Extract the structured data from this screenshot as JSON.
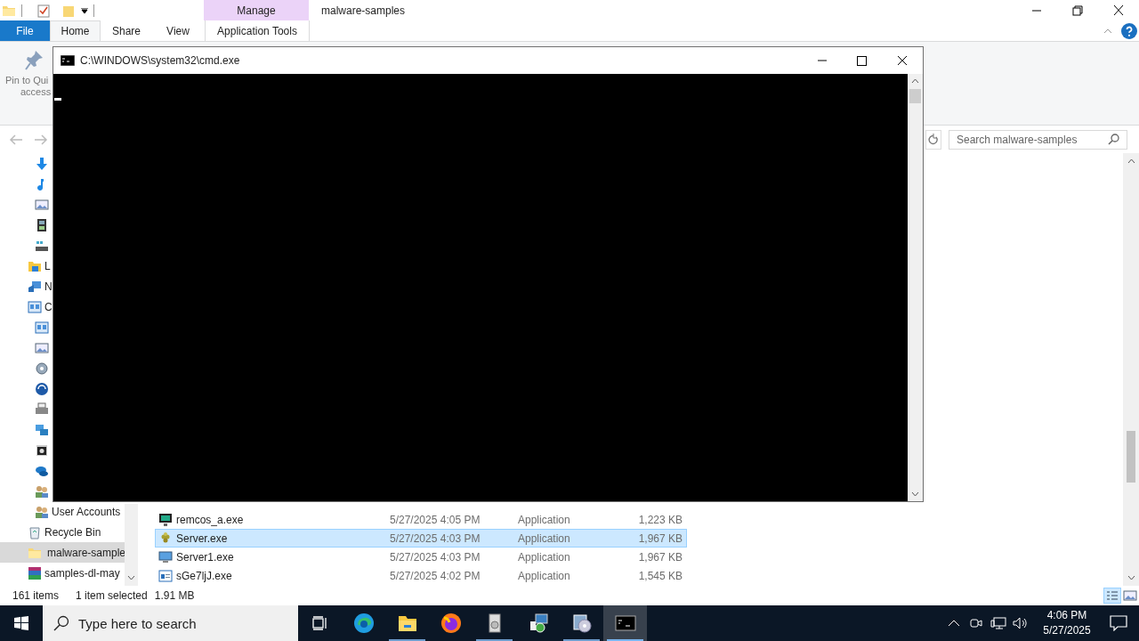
{
  "explorer": {
    "title": "malware-samples",
    "context_tab": {
      "group": "Manage",
      "label": "Application Tools"
    },
    "ribbon_tabs": [
      {
        "label": "File",
        "kind": "file",
        "selected": false
      },
      {
        "label": "Home",
        "kind": "tab",
        "selected": true
      },
      {
        "label": "Share",
        "kind": "tab",
        "selected": false
      },
      {
        "label": "View",
        "kind": "tab",
        "selected": false
      }
    ],
    "ribbon": {
      "pin_label": "Pin to Qui",
      "pin_label_2": "access"
    },
    "search": {
      "placeholder": "Search malware-samples"
    },
    "nav_pane": {
      "items": [
        {
          "selected": false
        },
        {
          "selected": false
        },
        {
          "selected": false
        },
        {
          "selected": false
        },
        {
          "selected": false
        },
        {
          "label": "L",
          "selected": false
        },
        {
          "label": "N",
          "selected": false
        },
        {
          "label": "C",
          "selected": false,
          "children": [
            {
              "selected": false
            },
            {
              "selected": false
            },
            {
              "selected": false
            },
            {
              "selected": false
            },
            {
              "selected": false
            },
            {
              "selected": false
            },
            {
              "selected": false
            },
            {
              "selected": false
            },
            {
              "selected": false
            },
            {
              "label": "User Accounts",
              "selected": false
            }
          ]
        },
        {
          "label": "Recycle Bin",
          "selected": false
        },
        {
          "label": "malware-sample",
          "selected": true
        },
        {
          "label": "samples-dl-may",
          "selected": false
        }
      ]
    },
    "files": [
      {
        "name": "remcos_a.exe",
        "date": "5/27/2025 4:05 PM",
        "type": "Application",
        "size": "1,223 KB",
        "selected": false
      },
      {
        "name": "Server.exe",
        "date": "5/27/2025 4:03 PM",
        "type": "Application",
        "size": "1,967 KB",
        "selected": true
      },
      {
        "name": "Server1.exe",
        "date": "5/27/2025 4:03 PM",
        "type": "Application",
        "size": "1,967 KB",
        "selected": false
      },
      {
        "name": "sGe7ljJ.exe",
        "date": "5/27/2025 4:02 PM",
        "type": "Application",
        "size": "1,545 KB",
        "selected": false
      }
    ],
    "status_bar": {
      "count": "161 items",
      "selection": "1 item selected",
      "size": "1.91 MB"
    }
  },
  "console": {
    "title": "C:\\WINDOWS\\system32\\cmd.exe"
  },
  "taskbar": {
    "search_placeholder": "Type here to search",
    "apps": [
      {
        "running": false,
        "active": false
      },
      {
        "running": true,
        "active": false
      },
      {
        "running": false,
        "active": false
      },
      {
        "running": true,
        "active": false
      },
      {
        "running": false,
        "active": false
      },
      {
        "running": true,
        "active": false
      },
      {
        "running": true,
        "active": true
      }
    ],
    "time": "4:06 PM",
    "date": "5/27/2025"
  }
}
